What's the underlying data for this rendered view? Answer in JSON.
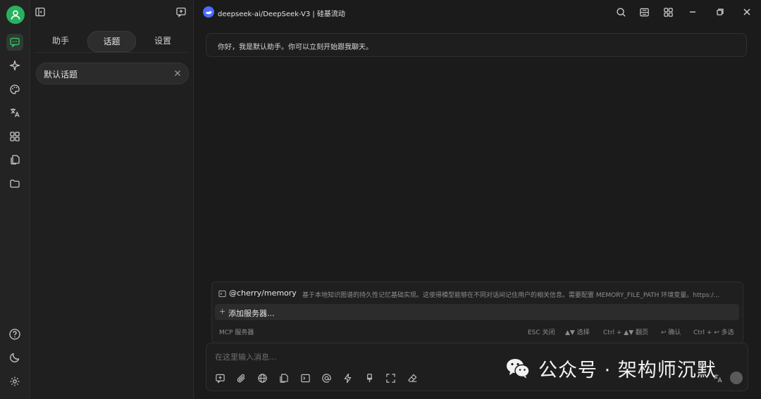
{
  "window": {
    "model_title": "deepseek-ai/DeepSeek-V3 | 硅基流动"
  },
  "rail": {
    "items": [
      "chat-icon",
      "sparkle-icon",
      "palette-icon",
      "translate-icon",
      "apps-icon",
      "document-icon",
      "folder-icon"
    ],
    "bottom": [
      "help-icon",
      "moon-icon",
      "gear-icon"
    ]
  },
  "panel": {
    "tabs": [
      {
        "label": "助手"
      },
      {
        "label": "话题",
        "active": true
      },
      {
        "label": "设置"
      }
    ],
    "topics": [
      {
        "label": "默认话题"
      }
    ]
  },
  "chat": {
    "greeting": "你好，我是默认助手。你可以立刻开始跟我聊天。"
  },
  "mcp_popup": {
    "server_name": "@cherry/memory",
    "server_desc": "基于本地知识图谱的持久性记忆基础实现。这使得模型能够在不同对话间记住用户的相关信息。需要配置 MEMORY_FILE_PATH 环境变量。https:/...",
    "add_server": "添加服务器...",
    "footer_title": "MCP 服务器",
    "hints": [
      "ESC 关闭",
      "▲▼ 选择",
      "Ctrl + ▲▼ 翻页",
      "↩ 确认",
      "Ctrl + ↩ 多选"
    ]
  },
  "input": {
    "placeholder": "在这里输入消息..."
  },
  "watermark": {
    "text": "公众号 · 架构师沉默"
  },
  "colors": {
    "accent": "#36c16a",
    "avatar": "#28b25e",
    "model_badge": "#4d6bfe",
    "background": "#1b1b1b"
  }
}
